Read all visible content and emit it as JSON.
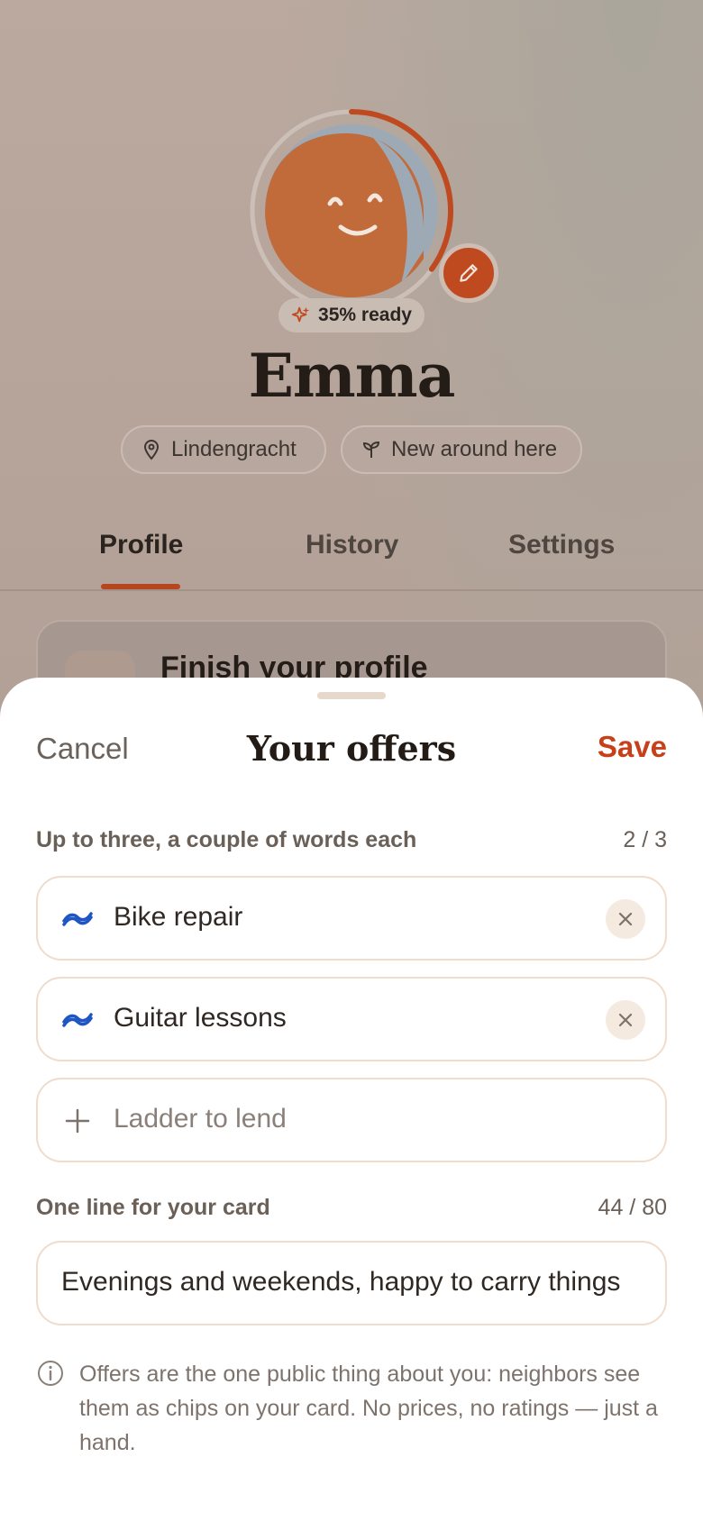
{
  "profile": {
    "name": "Emma",
    "readiness": "35% ready",
    "readiness_fraction": 0.35,
    "location_chip": "Lindengracht",
    "status_chip": "New around here",
    "tabs": [
      {
        "label": "Profile",
        "active": true
      },
      {
        "label": "History",
        "active": false
      },
      {
        "label": "Settings",
        "active": false
      }
    ],
    "finish_card_title": "Finish your profile",
    "accent_color": "#c04a20"
  },
  "sheet": {
    "cancel_label": "Cancel",
    "title": "Your offers",
    "save_label": "Save",
    "offers_label": "Up to three, a couple of words each",
    "offers_count": "2 / 3",
    "offers": [
      {
        "label": "Bike repair",
        "icon": "handshake-icon"
      },
      {
        "label": "Guitar lessons",
        "icon": "handshake-icon"
      }
    ],
    "add_offer_placeholder": "Ladder to lend",
    "card_line_label": "One line for your card",
    "card_line_count": "44 / 80",
    "card_line_value": "Evenings and weekends, happy to carry things",
    "info_text": "Offers are the one public thing about you: neighbors see them as chips on your card. No prices, no ratings — just a hand."
  }
}
